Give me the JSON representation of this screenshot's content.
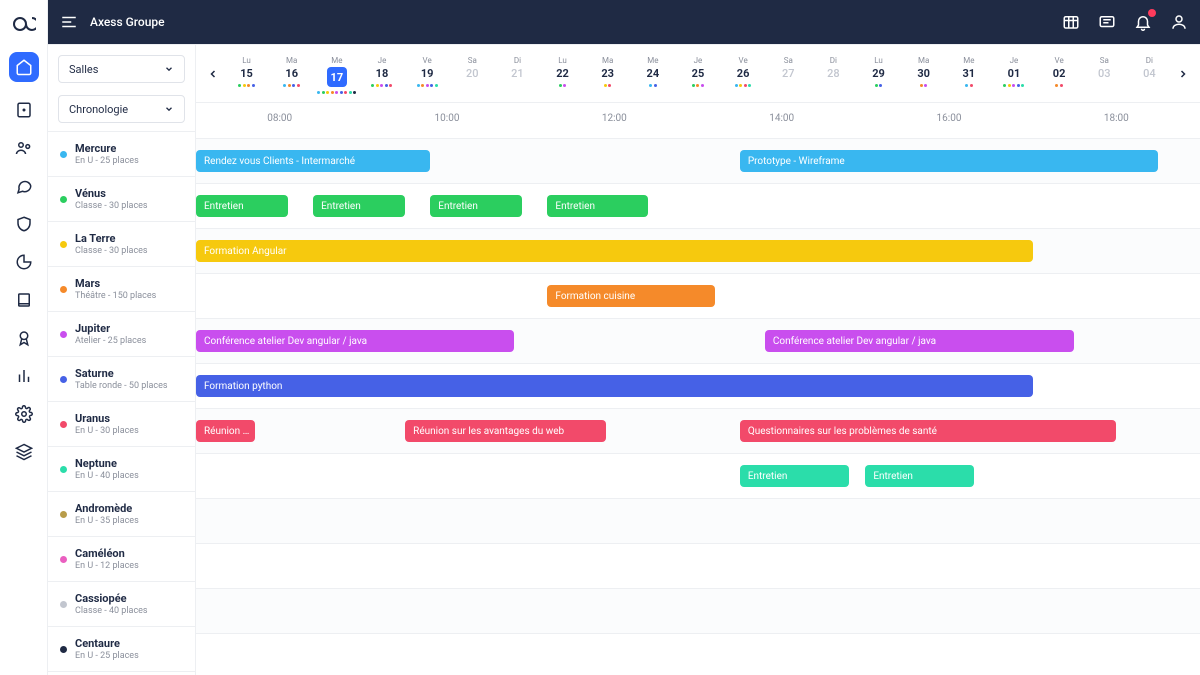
{
  "header": {
    "title": "Axess Groupe"
  },
  "filters": {
    "rooms_label": "Salles",
    "view_label": "Chronologie"
  },
  "colors": {
    "blue": "#39b7f0",
    "green": "#2bce5f",
    "yellow": "#f6c90e",
    "orange": "#f58a2a",
    "magenta": "#c94eee",
    "indigo": "#4661e6",
    "red": "#f24a6a",
    "mint": "#2bddaa"
  },
  "rooms": [
    {
      "name": "Mercure",
      "sub": "En U - 25 places",
      "dot": "#39b7f0"
    },
    {
      "name": "Vénus",
      "sub": "Classe - 30 places",
      "dot": "#2bce5f"
    },
    {
      "name": "La Terre",
      "sub": "Classe - 30 places",
      "dot": "#f6c90e"
    },
    {
      "name": "Mars",
      "sub": "Théâtre - 150 places",
      "dot": "#f58a2a"
    },
    {
      "name": "Jupiter",
      "sub": "Atelier - 25 places",
      "dot": "#c94eee"
    },
    {
      "name": "Saturne",
      "sub": "Table ronde - 50 places",
      "dot": "#4661e6"
    },
    {
      "name": "Uranus",
      "sub": "En U - 30 places",
      "dot": "#f24a6a"
    },
    {
      "name": "Neptune",
      "sub": "En U - 40 places",
      "dot": "#2bddaa"
    },
    {
      "name": "Andromède",
      "sub": "En U - 35 places",
      "dot": "#b89c4a"
    },
    {
      "name": "Caméléon",
      "sub": "En U - 12 places",
      "dot": "#ea5fc0"
    },
    {
      "name": "Cassiopée",
      "sub": "Classe - 40 places",
      "dot": "#c2c6cf"
    },
    {
      "name": "Centaure",
      "sub": "En U - 25 places",
      "dot": "#1f2a44"
    }
  ],
  "days": [
    {
      "dow": "Lu",
      "num": "15",
      "muted": false,
      "selected": false,
      "dots": [
        "#2bce5f",
        "#f6c90e",
        "#f58a2a",
        "#4661e6"
      ]
    },
    {
      "dow": "Ma",
      "num": "16",
      "muted": false,
      "selected": false,
      "dots": [
        "#39b7f0",
        "#f58a2a",
        "#4661e6",
        "#f24a6a"
      ]
    },
    {
      "dow": "Me",
      "num": "17",
      "muted": false,
      "selected": true,
      "dots": [
        "#39b7f0",
        "#2bce5f",
        "#f6c90e",
        "#f58a2a",
        "#c94eee",
        "#4661e6",
        "#f24a6a",
        "#2bddaa",
        "#1f2a44"
      ]
    },
    {
      "dow": "Je",
      "num": "18",
      "muted": false,
      "selected": false,
      "dots": [
        "#2bce5f",
        "#f6c90e",
        "#c94eee",
        "#4661e6",
        "#f24a6a"
      ]
    },
    {
      "dow": "Ve",
      "num": "19",
      "muted": false,
      "selected": false,
      "dots": [
        "#39b7f0",
        "#f58a2a",
        "#c94eee",
        "#4661e6",
        "#2bddaa"
      ]
    },
    {
      "dow": "Sa",
      "num": "20",
      "muted": true,
      "selected": false,
      "dots": []
    },
    {
      "dow": "Di",
      "num": "21",
      "muted": true,
      "selected": false,
      "dots": []
    },
    {
      "dow": "Lu",
      "num": "22",
      "muted": false,
      "selected": false,
      "dots": [
        "#2bce5f",
        "#c94eee"
      ]
    },
    {
      "dow": "Ma",
      "num": "23",
      "muted": false,
      "selected": false,
      "dots": [
        "#f6c90e",
        "#f24a6a"
      ]
    },
    {
      "dow": "Me",
      "num": "24",
      "muted": false,
      "selected": false,
      "dots": [
        "#39b7f0",
        "#4661e6"
      ]
    },
    {
      "dow": "Je",
      "num": "25",
      "muted": false,
      "selected": false,
      "dots": [
        "#2bce5f",
        "#f58a2a",
        "#c94eee"
      ]
    },
    {
      "dow": "Ve",
      "num": "26",
      "muted": false,
      "selected": false,
      "dots": [
        "#39b7f0",
        "#f6c90e",
        "#f24a6a",
        "#2bddaa"
      ]
    },
    {
      "dow": "Sa",
      "num": "27",
      "muted": true,
      "selected": false,
      "dots": []
    },
    {
      "dow": "Di",
      "num": "28",
      "muted": true,
      "selected": false,
      "dots": []
    },
    {
      "dow": "Lu",
      "num": "29",
      "muted": false,
      "selected": false,
      "dots": [
        "#2bce5f",
        "#4661e6"
      ]
    },
    {
      "dow": "Ma",
      "num": "30",
      "muted": false,
      "selected": false,
      "dots": [
        "#f58a2a",
        "#c94eee"
      ]
    },
    {
      "dow": "Me",
      "num": "31",
      "muted": false,
      "selected": false,
      "dots": [
        "#39b7f0",
        "#f24a6a"
      ]
    },
    {
      "dow": "Je",
      "num": "01",
      "muted": false,
      "selected": false,
      "dots": [
        "#2bce5f",
        "#f6c90e",
        "#c94eee",
        "#4661e6",
        "#2bddaa"
      ]
    },
    {
      "dow": "Ve",
      "num": "02",
      "muted": false,
      "selected": false,
      "dots": [
        "#f58a2a",
        "#f24a6a"
      ]
    },
    {
      "dow": "Sa",
      "num": "03",
      "muted": true,
      "selected": false,
      "dots": []
    },
    {
      "dow": "Di",
      "num": "04",
      "muted": true,
      "selected": false,
      "dots": []
    }
  ],
  "time_axis": {
    "start": 7,
    "end": 19,
    "labels": [
      {
        "h": 8,
        "text": "08:00"
      },
      {
        "h": 10,
        "text": "10:00"
      },
      {
        "h": 12,
        "text": "12:00"
      },
      {
        "h": 14,
        "text": "14:00"
      },
      {
        "h": 16,
        "text": "16:00"
      },
      {
        "h": 18,
        "text": "18:00"
      }
    ]
  },
  "events": [
    {
      "room": 0,
      "label": "Rendez vous Clients - Intermarché",
      "start": 7.0,
      "end": 9.8,
      "color": "#39b7f0"
    },
    {
      "room": 0,
      "label": "Prototype - Wireframe",
      "start": 13.5,
      "end": 18.5,
      "color": "#39b7f0"
    },
    {
      "room": 1,
      "label": "Entretien",
      "start": 7.0,
      "end": 8.1,
      "color": "#2bce5f"
    },
    {
      "room": 1,
      "label": "Entretien",
      "start": 8.4,
      "end": 9.5,
      "color": "#2bce5f"
    },
    {
      "room": 1,
      "label": "Entretien",
      "start": 9.8,
      "end": 10.9,
      "color": "#2bce5f"
    },
    {
      "room": 1,
      "label": "Entretien",
      "start": 11.2,
      "end": 12.4,
      "color": "#2bce5f"
    },
    {
      "room": 2,
      "label": "Formation Angular",
      "start": 7.0,
      "end": 17.0,
      "color": "#f6c90e"
    },
    {
      "room": 3,
      "label": "Formation cuisine",
      "start": 11.2,
      "end": 13.2,
      "color": "#f58a2a"
    },
    {
      "room": 4,
      "label": "Conférence atelier Dev angular / java",
      "start": 7.0,
      "end": 10.8,
      "color": "#c94eee"
    },
    {
      "room": 4,
      "label": "Conférence atelier Dev angular / java",
      "start": 13.8,
      "end": 17.5,
      "color": "#c94eee"
    },
    {
      "room": 5,
      "label": "Formation python",
      "start": 7.0,
      "end": 17.0,
      "color": "#4661e6"
    },
    {
      "room": 6,
      "label": "Réunion …",
      "start": 7.0,
      "end": 7.7,
      "color": "#f24a6a"
    },
    {
      "room": 6,
      "label": "Réunion sur les avantages du web",
      "start": 9.5,
      "end": 11.9,
      "color": "#f24a6a"
    },
    {
      "room": 6,
      "label": "Questionnaires sur les problèmes de santé",
      "start": 13.5,
      "end": 18.0,
      "color": "#f24a6a"
    },
    {
      "room": 7,
      "label": "Entretien",
      "start": 13.5,
      "end": 14.8,
      "color": "#2bddaa"
    },
    {
      "room": 7,
      "label": "Entretien",
      "start": 15.0,
      "end": 16.3,
      "color": "#2bddaa"
    }
  ]
}
